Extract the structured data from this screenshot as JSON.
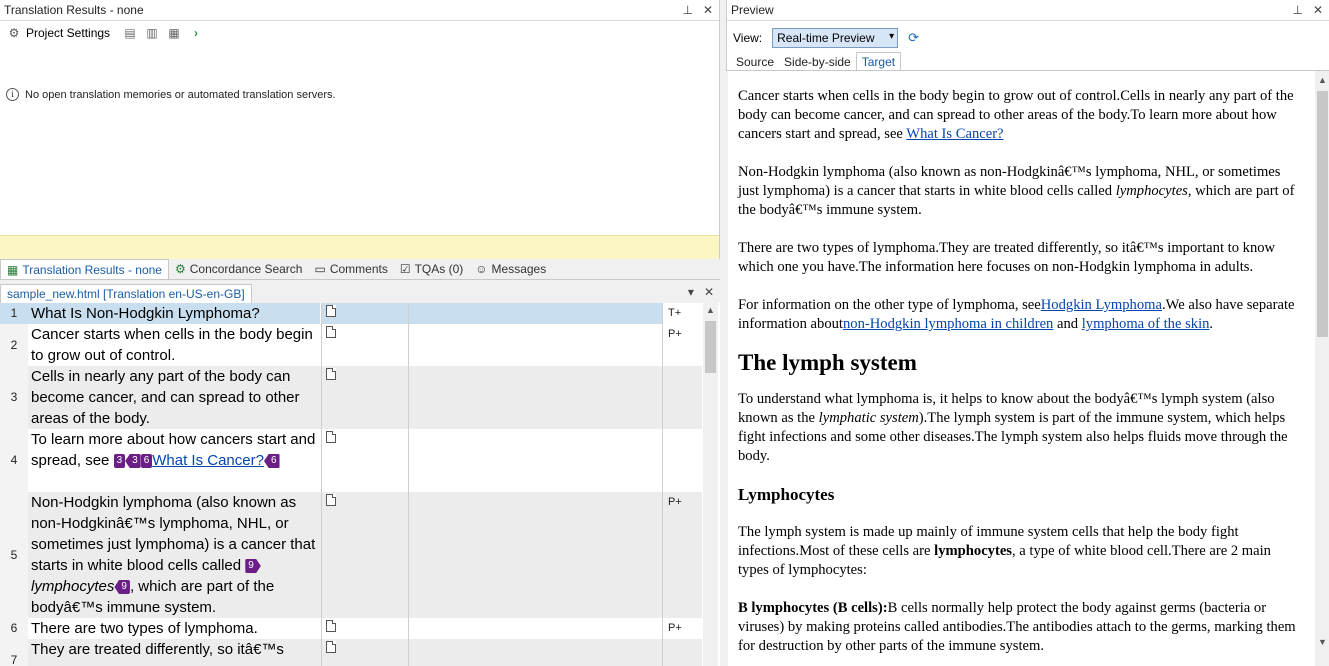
{
  "left_top": {
    "title": "Translation Results - none",
    "toolbar": {
      "project_settings": "Project Settings"
    },
    "info_message": "No open translation memories or automated translation servers."
  },
  "bottom_tabs": [
    {
      "label": "Translation Results - none",
      "icon": "translation-results-icon"
    },
    {
      "label": "Concordance Search",
      "icon": "concordance-icon"
    },
    {
      "label": "Comments",
      "icon": "comments-icon"
    },
    {
      "label": "TQAs (0)",
      "icon": "tqa-icon"
    },
    {
      "label": "Messages",
      "icon": "messages-icon"
    }
  ],
  "document_tab": "sample_new.html [Translation en-US-en-GB]",
  "segments": [
    {
      "num": "1",
      "status": "T+",
      "text": "What Is Non-Hodgkin Lymphoma?"
    },
    {
      "num": "2",
      "status": "P+",
      "text": "Cancer starts when cells in the body begin to grow out of control."
    },
    {
      "num": "3",
      "status": "",
      "text": "Cells in nearly any part of the body can become cancer, and can spread to other areas of the body."
    },
    {
      "num": "4",
      "status": "",
      "text_before": "To learn more about how cancers start and spread, see ",
      "tag1": "3",
      "tag2": "3",
      "tag3": "6",
      "link": "What Is Cancer?",
      "tag4": "6"
    },
    {
      "num": "5",
      "status": "P+",
      "text_before": "Non-Hodgkin lymphoma (also known as non-Hodgkinâ€™s lymphoma, NHL, or sometimes just lymphoma) is a cancer that starts in white blood cells called ",
      "tag1": "9",
      "ital": "lymphocytes",
      "tag2": "9",
      "text_after": ", which are part of the bodyâ€™s immune system."
    },
    {
      "num": "6",
      "status": "P+",
      "text": "There are two types of lymphoma."
    },
    {
      "num": "7",
      "status": "",
      "text": "They are treated differently, so itâ€™s"
    }
  ],
  "preview": {
    "title": "Preview",
    "view_label": "View:",
    "view_value": "Real-time Preview",
    "tabs": [
      "Source",
      "Side-by-side",
      "Target"
    ],
    "p1": "Cancer starts when cells in the body begin to grow out of control.Cells in nearly any part of the body can become cancer, and can spread to other areas of the body.To learn more about how cancers start and spread, see ",
    "p1_link": "What Is Cancer?",
    "p2a": "Non-Hodgkin lymphoma (also known as non-Hodgkinâ€™s lymphoma, NHL, or sometimes just lymphoma) is a cancer that starts in white blood cells called ",
    "p2_ital": "lymphocytes",
    "p2b": ", which are part of the bodyâ€™s immune system.",
    "p3": "There are two types of lymphoma.They are treated differently, so itâ€™s important to know which one you have.The information here focuses on non-Hodgkin lymphoma in adults.",
    "p4a": "For information on the other type of lymphoma, see",
    "p4_link1": "Hodgkin Lymphoma",
    "p4b": ".We also have separate information about",
    "p4_link2": "non-Hodgkin lymphoma in children",
    "p4c": " and ",
    "p4_link3": "lymphoma of the skin",
    "p4d": ".",
    "h2": "The lymph system",
    "p5a": "To understand what lymphoma is, it helps to know about the bodyâ€™s lymph system (also known as the ",
    "p5_ital": "lymphatic system",
    "p5b": ").The lymph system is part of the immune system, which helps fight infections and some other diseases.The lymph system also helps fluids move through the body.",
    "h3": "Lymphocytes",
    "p6a": "The lymph system is made up mainly of immune system cells that help the body fight infections.Most of these cells are ",
    "p6_bold": "lymphocytes",
    "p6b": ", a type of white blood cell.There are 2 main types of lymphocytes:",
    "p7_bold": "B lymphocytes (B cells):",
    "p7": "B cells normally help protect the body against germs (bacteria or viruses) by making proteins called antibodies.The antibodies attach to the germs, marking them for destruction by other parts of the immune system."
  }
}
